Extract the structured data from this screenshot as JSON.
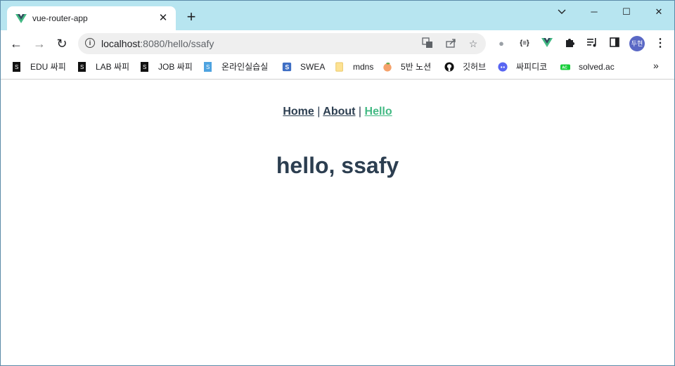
{
  "tab": {
    "title": "vue-router-app",
    "close": "✕",
    "new_tab": "+"
  },
  "window": {
    "minimize": "─",
    "maximize": "☐",
    "close": "✕"
  },
  "toolbar": {
    "back": "←",
    "forward": "→",
    "reload": "↻",
    "url_host": "localhost",
    "url_rest": ":8080/hello/ssafy",
    "profile_initials": "두현"
  },
  "bookmarks": [
    {
      "label": "EDU 싸피",
      "icon": "ssafy-icon"
    },
    {
      "label": "LAB 싸피",
      "icon": "ssafy-icon"
    },
    {
      "label": "JOB 싸피",
      "icon": "ssafy-icon"
    },
    {
      "label": "온라인실습실",
      "icon": "ssafy-blue-icon"
    },
    {
      "label": "SWEA",
      "icon": "swea-icon"
    },
    {
      "label": "mdns",
      "icon": "folder-icon"
    },
    {
      "label": "5반 노션",
      "icon": "peach-icon"
    },
    {
      "label": "깃허브",
      "icon": "github-icon"
    },
    {
      "label": "싸피디코",
      "icon": "discord-icon"
    },
    {
      "label": "solved.ac",
      "icon": "solvedac-icon"
    }
  ],
  "bookmarks_more": "»",
  "nav": {
    "home": "Home",
    "about": "About",
    "hello": "Hello",
    "sep": "|"
  },
  "heading": "hello, ssafy",
  "colors": {
    "accent": "#42b983",
    "text": "#2c3e50",
    "tabstrip": "#b7e5f0"
  }
}
